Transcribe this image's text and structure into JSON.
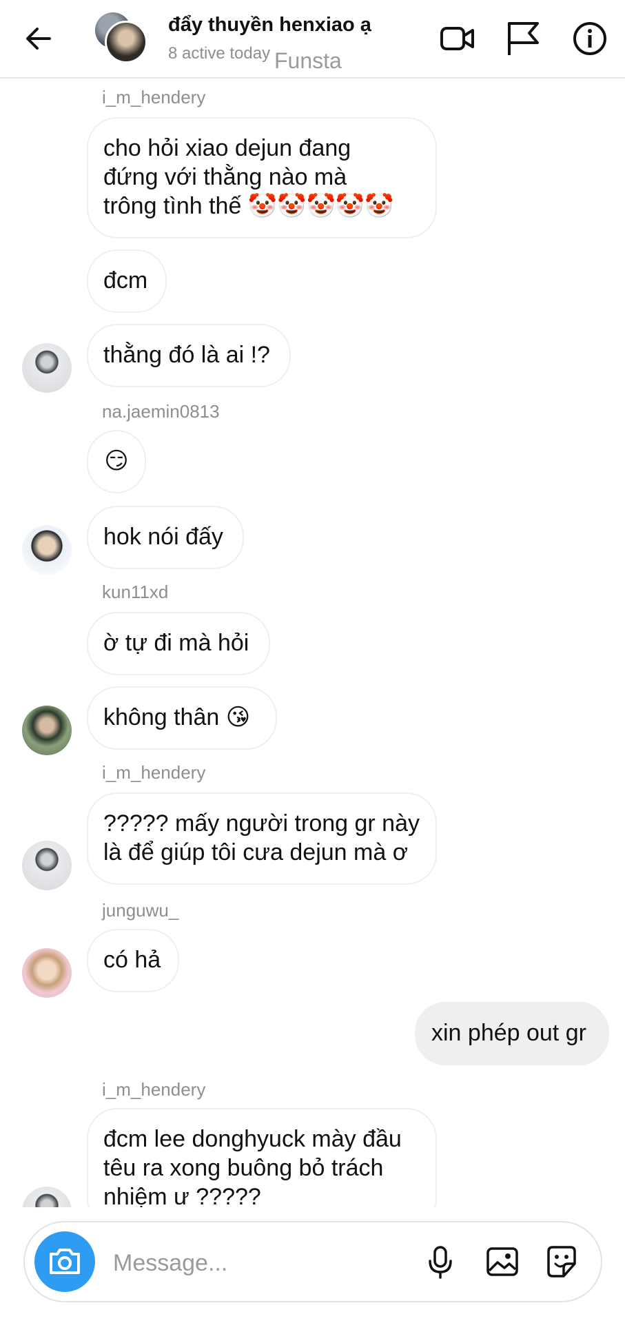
{
  "header": {
    "title": "đẩy thuyền henxiao ạ",
    "subtitle": "8 active today",
    "watermark": "Funsta",
    "icons": [
      "back-arrow-icon",
      "video-camera-icon",
      "flag-icon",
      "info-icon"
    ]
  },
  "messages": [
    {
      "username": "i_m_hendery",
      "text": "cho hỏi xiao dejun đang\nđứng với thằng nào mà\ntrông tình thế 🤡🤡🤡🤡🤡"
    },
    {
      "text": "đcm"
    },
    {
      "text": "thằng đó là ai !?"
    },
    {
      "username": "na.jaemin0813",
      "text": "😏"
    },
    {
      "text": "hok nói đấy"
    },
    {
      "username": "kun11xd",
      "text": "ờ tự đi mà hỏi"
    },
    {
      "text": "không thân 😘"
    },
    {
      "username": "i_m_hendery",
      "text": "????? mấy người trong gr này\nlà để giúp tôi cưa dejun mà ơ"
    },
    {
      "username": "junguwu_",
      "text": "có hả"
    },
    {
      "text": "xin phép out gr",
      "mine": true
    },
    {
      "username": "i_m_hendery",
      "text": "đcm lee donghyuck mày đầu\ntêu ra xong buông bỏ trách\nnhiệm ư ?????"
    }
  ],
  "composer": {
    "placeholder": "Message...",
    "icons": [
      "camera-icon",
      "microphone-icon",
      "gallery-icon",
      "sticker-icon"
    ]
  },
  "colors": {
    "accent": "#2f9cf4",
    "bubble_border": "#efefef",
    "own_bubble": "#efefef",
    "muted_text": "#8e8e8e"
  }
}
